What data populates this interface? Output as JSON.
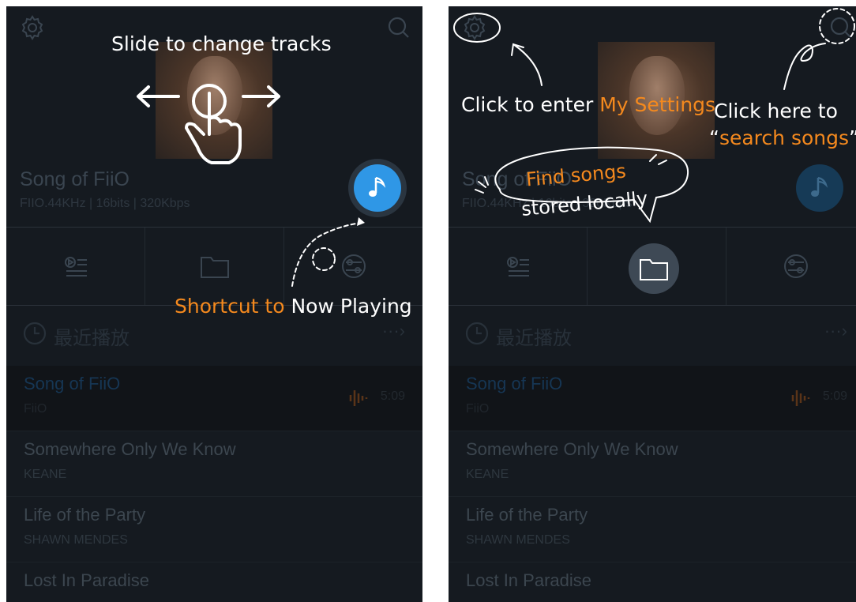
{
  "colors": {
    "accent": "#f4891e",
    "play_blue": "#2f97e6",
    "bg": "#151a20"
  },
  "left": {
    "now_playing": {
      "title": "Song of FiiO",
      "meta": "FIIO.44KHz | 16bits | 320Kbps"
    },
    "recent": {
      "label": "最近播放",
      "more": "···›"
    },
    "songs": [
      {
        "title": "Song of FiiO",
        "artist": "FiiO",
        "duration": "5:09"
      },
      {
        "title": "Somewhere Only We Know",
        "artist": "KEANE"
      },
      {
        "title": "Life of the Party",
        "artist": "SHAWN MENDES"
      },
      {
        "title": "Lost In Paradise",
        "artist": ""
      }
    ],
    "hints": {
      "slide": "Slide to change tracks",
      "shortcut_accent": "Shortcut to",
      "shortcut_rest": " Now Playing"
    }
  },
  "right": {
    "now_playing": {
      "title": "Song of FiiO",
      "meta": "FIIO.44KHz | 16bits | 320Kbps"
    },
    "recent": {
      "label": "最近播放",
      "more": "···›"
    },
    "songs": [
      {
        "title": "Song of FiiO",
        "artist": "FiiO",
        "duration": "5:09"
      },
      {
        "title": "Somewhere Only We Know",
        "artist": "KEANE"
      },
      {
        "title": "Life of the Party",
        "artist": "SHAWN MENDES"
      },
      {
        "title": "Lost In Paradise",
        "artist": ""
      }
    ],
    "hints": {
      "settings_prefix": "Click to enter ",
      "settings_accent": "My Settings",
      "search_line1": "Click here to",
      "search_quote_open": "“",
      "search_accent": "search songs",
      "search_quote_close": "”",
      "find_accent": "Find songs",
      "find_rest": "stored locally"
    }
  },
  "icons": {
    "settings": "gear-icon",
    "search": "search-icon",
    "playlist": "playlist-icon",
    "folder": "folder-icon",
    "category": "category-icon",
    "music_note": "music-note-icon",
    "clock": "clock-icon",
    "swipe_hand": "hand-pointer-icon"
  }
}
